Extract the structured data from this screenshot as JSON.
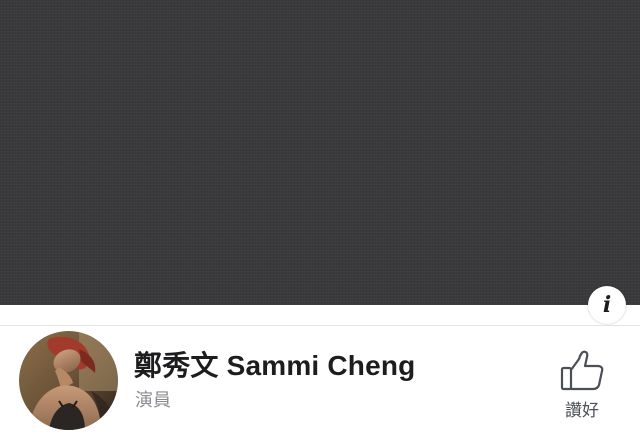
{
  "cover": {
    "background_color": "#3a393c"
  },
  "info_button": {
    "glyph": "i",
    "icon": "info-icon"
  },
  "profile": {
    "name": "鄭秀文 Sammi Cheng",
    "category": "演員",
    "avatar_icon": "profile-photo"
  },
  "like_button": {
    "label": "讚好",
    "icon": "thumbs-up-icon"
  },
  "colors": {
    "name_text": "#1d1d1f",
    "secondary_text": "#8a8d91",
    "divider": "#e3e4e6",
    "icon": "#4b4f56"
  }
}
